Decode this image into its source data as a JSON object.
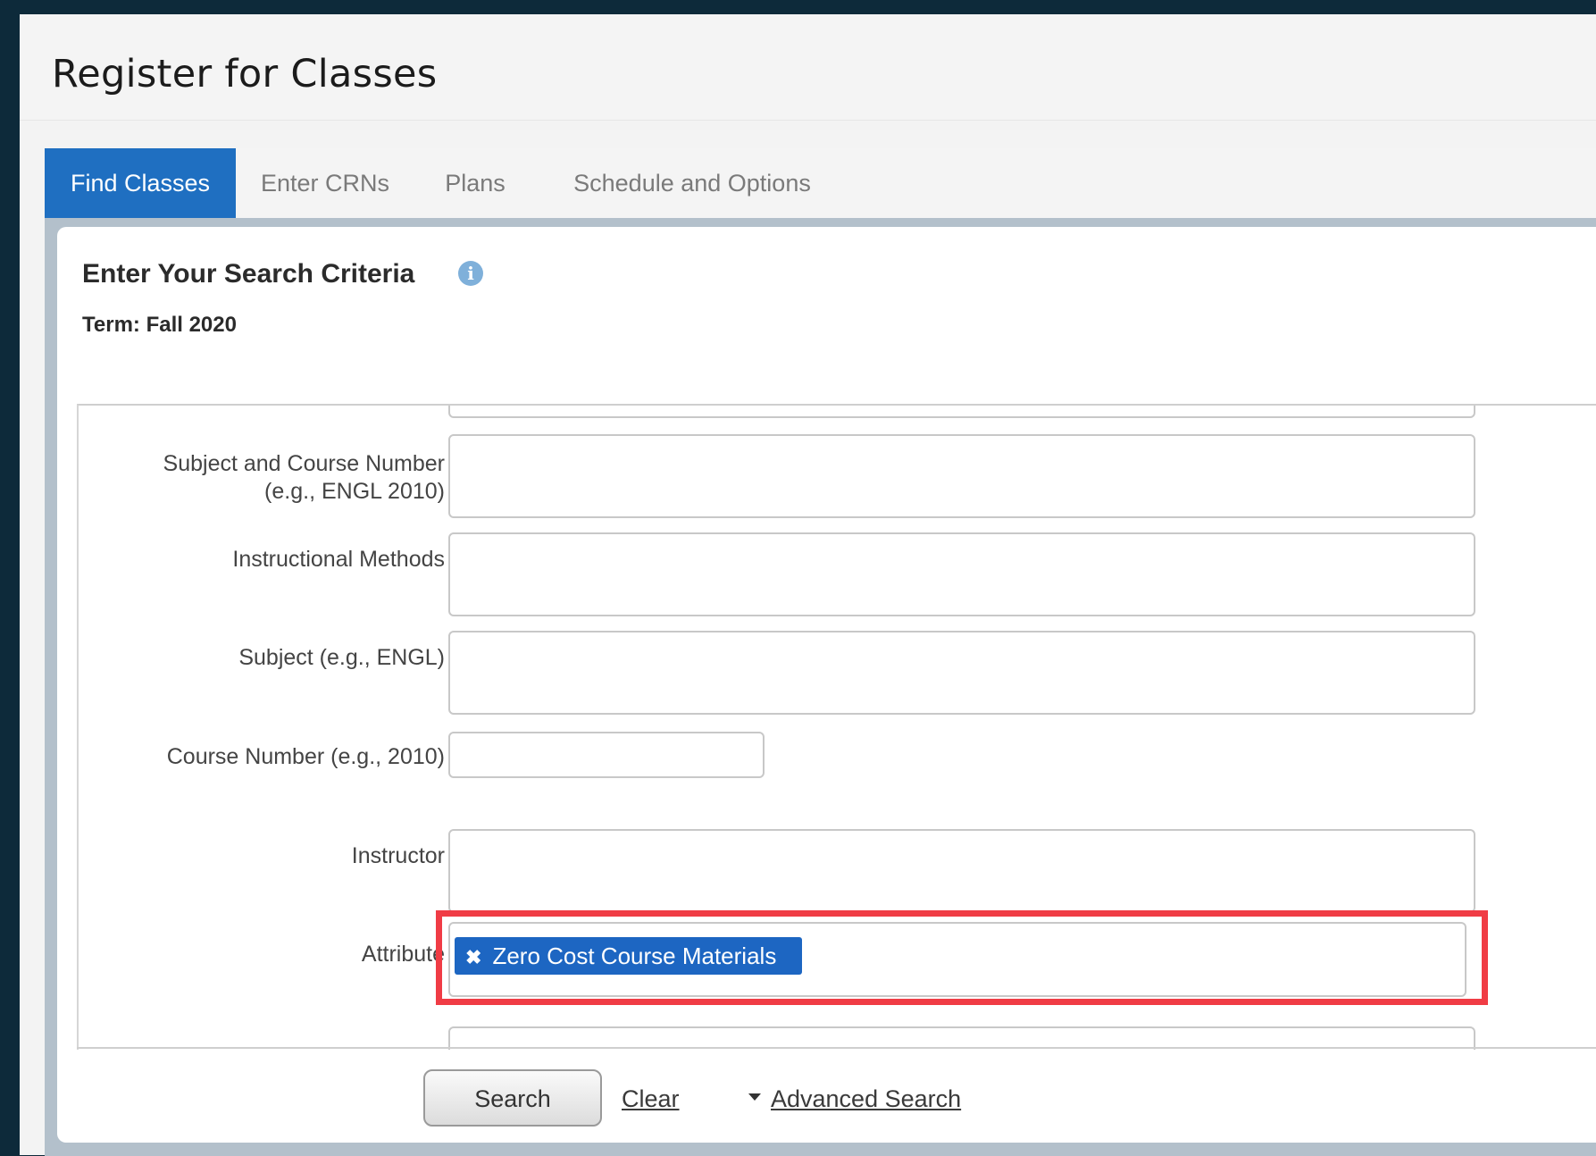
{
  "page": {
    "title": "Register for Classes"
  },
  "tabs": [
    {
      "label": "Find Classes",
      "active": true
    },
    {
      "label": "Enter CRNs",
      "active": false
    },
    {
      "label": "Plans",
      "active": false
    },
    {
      "label": "Schedule and Options",
      "active": false
    }
  ],
  "search": {
    "title": "Enter Your Search Criteria",
    "term": "Term: Fall 2020",
    "fields": {
      "subject_course_label_line1": "Subject and Course Number",
      "subject_course_label_line2": "(e.g., ENGL 2010)",
      "instructional_methods_label": "Instructional Methods",
      "subject_label": "Subject (e.g., ENGL)",
      "course_number_label": "Course Number (e.g., 2010)",
      "instructor_label": "Instructor",
      "attribute_label": "Attribute",
      "attribute_selected": "Zero Cost Course Materials",
      "attribute_remove_glyph": "✖"
    },
    "buttons": {
      "search": "Search",
      "clear": "Clear",
      "advanced": "Advanced Search"
    }
  },
  "colors": {
    "active_tab": "#1f6fc1",
    "chip": "#1d66c2",
    "highlight": "#f03c45"
  }
}
